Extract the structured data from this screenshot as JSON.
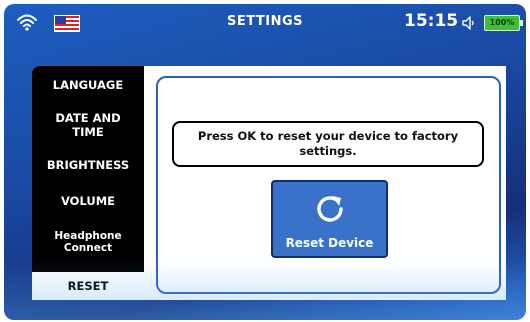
{
  "status_bar": {
    "title": "SETTINGS",
    "time": "15:15",
    "battery_label": "100%",
    "icons": [
      "wifi-icon",
      "us-flag-icon",
      "speaker-icon",
      "battery-icon"
    ]
  },
  "sidebar": {
    "items": [
      {
        "label": "LANGUAGE"
      },
      {
        "label_lines": [
          "DATE AND",
          "TIME"
        ]
      },
      {
        "label": "BRIGHTNESS"
      },
      {
        "label": "VOLUME"
      },
      {
        "label_lines": [
          "Headphone",
          "Connect"
        ]
      },
      {
        "label": "RESET",
        "active": true
      }
    ]
  },
  "main": {
    "message_lines": [
      "Press OK to reset your device to factory",
      "settings."
    ],
    "reset_button": {
      "label": "Reset Device",
      "icon": "refresh-icon"
    }
  },
  "colors": {
    "accent": "#3b72c9",
    "panel_border": "#2e5fbf",
    "battery": "#3fbf3a"
  }
}
